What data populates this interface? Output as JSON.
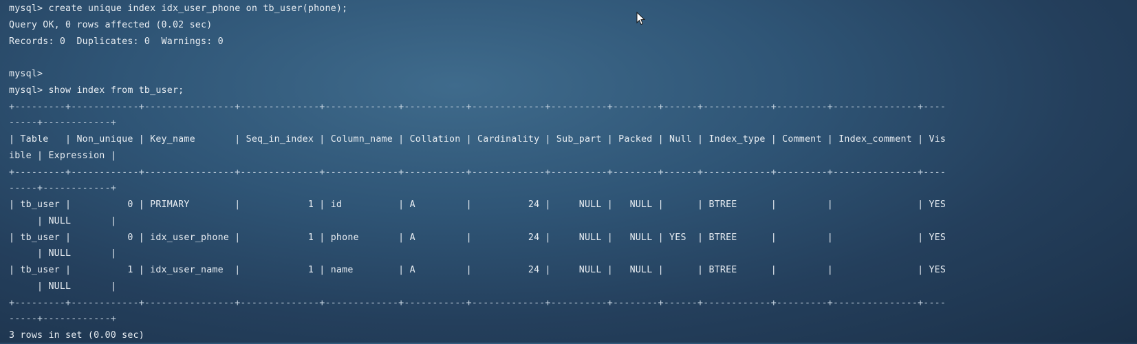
{
  "terminal": {
    "lines": [
      "mysql> create unique index idx_user_phone on tb_user(phone);",
      "Query OK, 0 rows affected (0.02 sec)",
      "Records: 0  Duplicates: 0  Warnings: 0",
      "",
      "mysql>",
      "mysql> show index from tb_user;",
      "+---------+------------+----------------+--------------+-------------+-----------+-------------+----------+--------+------+------------+---------+---------------+----",
      "-----+------------+",
      "| Table   | Non_unique | Key_name       | Seq_in_index | Column_name | Collation | Cardinality | Sub_part | Packed | Null | Index_type | Comment | Index_comment | Vis",
      "ible | Expression |",
      "+---------+------------+----------------+--------------+-------------+-----------+-------------+----------+--------+------+------------+---------+---------------+----",
      "-----+------------+",
      "| tb_user |          0 | PRIMARY        |            1 | id          | A         |          24 |     NULL |   NULL |      | BTREE      |         |               | YES",
      "     | NULL       |",
      "| tb_user |          0 | idx_user_phone |            1 | phone       | A         |          24 |     NULL |   NULL | YES  | BTREE      |         |               | YES",
      "     | NULL       |",
      "| tb_user |          1 | idx_user_name  |            1 | name        | A         |          24 |     NULL |   NULL |      | BTREE      |         |               | YES",
      "     | NULL       |",
      "+---------+------------+----------------+--------------+-------------+-----------+-------------+----------+--------+------+------------+---------+---------------+----",
      "-----+------------+",
      "3 rows in set (0.00 sec)"
    ]
  },
  "colors": {
    "text": "#e9eef3",
    "background": "#2f5576"
  },
  "icons": {
    "cursor": "mouse-pointer-icon"
  }
}
